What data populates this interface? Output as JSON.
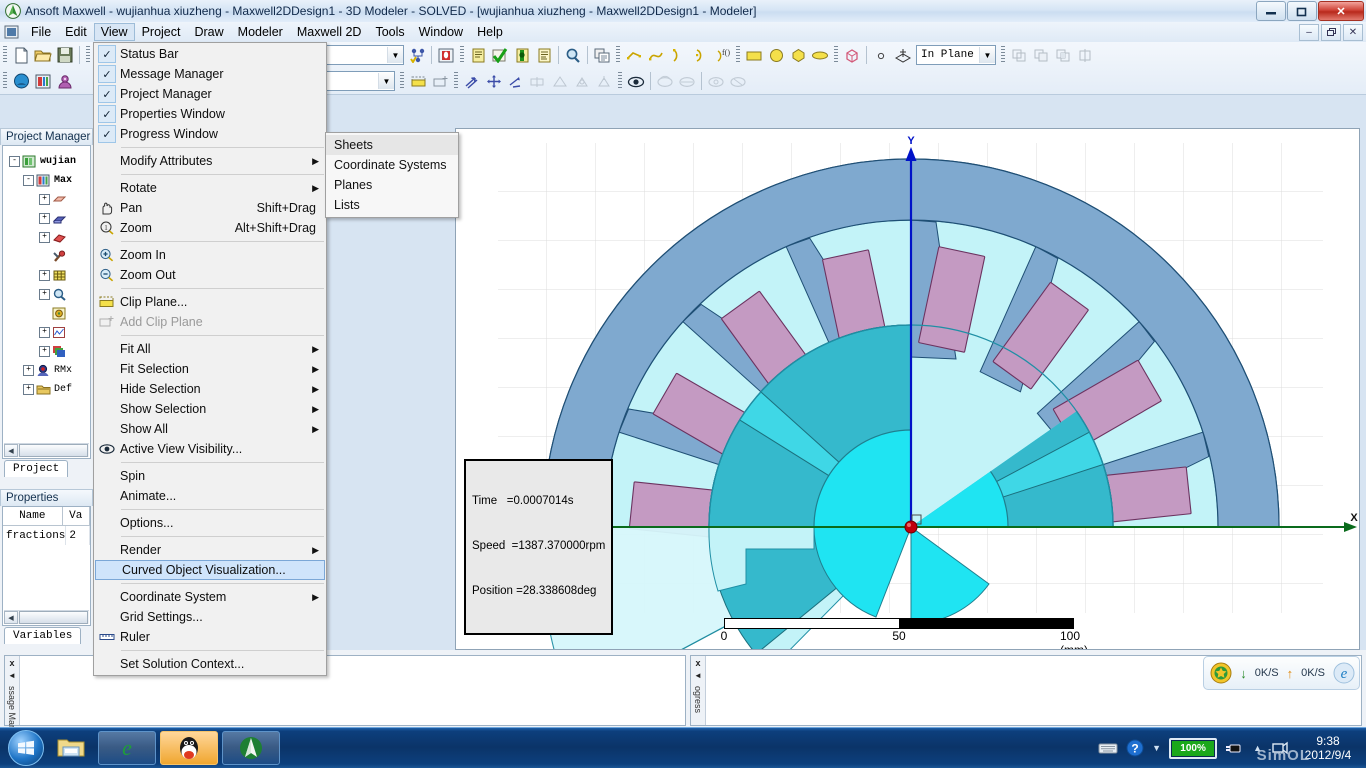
{
  "window": {
    "app_icon": "ansoft-logo-icon",
    "title": "Ansoft Maxwell  - wujianhua  xiuzheng - Maxwell2DDesign1 - 3D Modeler - SOLVED - [wujianhua  xiuzheng - Maxwell2DDesign1 - Modeler]",
    "minimize": "–",
    "maximize": "❐",
    "close": "✕",
    "mdi_minimize": "–",
    "mdi_restore": "❐",
    "mdi_close": "✕"
  },
  "menubar": {
    "items": [
      {
        "label": "File",
        "open": false
      },
      {
        "label": "Edit",
        "open": false
      },
      {
        "label": "View",
        "open": true
      },
      {
        "label": "Project",
        "open": false
      },
      {
        "label": "Draw",
        "open": false
      },
      {
        "label": "Modeler",
        "open": false
      },
      {
        "label": "Maxwell 2D",
        "open": false
      },
      {
        "label": "Tools",
        "open": false
      },
      {
        "label": "Window",
        "open": false
      },
      {
        "label": "Help",
        "open": false
      }
    ]
  },
  "view_menu": {
    "items": [
      {
        "label": "Status Bar",
        "type": "check",
        "checked": true
      },
      {
        "label": "Message Manager",
        "type": "check",
        "checked": true
      },
      {
        "label": "Project Manager",
        "type": "check",
        "checked": true
      },
      {
        "label": "Properties Window",
        "type": "check",
        "checked": true
      },
      {
        "label": "Progress Window",
        "type": "check",
        "checked": true
      },
      {
        "type": "separator"
      },
      {
        "label": "Modify Attributes",
        "type": "submenu"
      },
      {
        "type": "separator"
      },
      {
        "label": "Rotate",
        "type": "submenu"
      },
      {
        "label": "Pan",
        "shortcut": "Shift+Drag",
        "icon": "hand-icon"
      },
      {
        "label": "Zoom",
        "shortcut": "Alt+Shift+Drag",
        "icon": "zoom-icon"
      },
      {
        "type": "separator"
      },
      {
        "label": "Zoom In",
        "icon": "zoom-in-icon"
      },
      {
        "label": "Zoom Out",
        "icon": "zoom-out-icon"
      },
      {
        "type": "separator"
      },
      {
        "label": "Clip Plane...",
        "icon": "clip-plane-icon"
      },
      {
        "label": "Add Clip Plane",
        "icon": "add-clip-plane-icon",
        "disabled": true
      },
      {
        "type": "separator"
      },
      {
        "label": "Fit All",
        "type": "submenu"
      },
      {
        "label": "Fit Selection",
        "type": "submenu"
      },
      {
        "label": "Hide Selection",
        "type": "submenu"
      },
      {
        "label": "Show Selection",
        "type": "submenu"
      },
      {
        "label": "Show All",
        "type": "submenu"
      },
      {
        "label": "Active View Visibility...",
        "icon": "eye-icon"
      },
      {
        "type": "separator"
      },
      {
        "label": "Spin"
      },
      {
        "label": "Animate..."
      },
      {
        "type": "separator"
      },
      {
        "label": "Options..."
      },
      {
        "type": "separator"
      },
      {
        "label": "Render",
        "type": "submenu"
      },
      {
        "label": "Curved Object Visualization...",
        "selected": true
      },
      {
        "type": "separator"
      },
      {
        "label": "Coordinate System",
        "type": "submenu"
      },
      {
        "label": "Grid Settings..."
      },
      {
        "label": "Ruler",
        "icon": "ruler-icon"
      },
      {
        "type": "separator"
      },
      {
        "label": "Set Solution Context..."
      }
    ]
  },
  "submenu": {
    "items": [
      {
        "label": "Sheets",
        "highlighted": true
      },
      {
        "label": "Coordinate Systems"
      },
      {
        "label": "Planes"
      },
      {
        "label": "Lists"
      }
    ]
  },
  "toolbars": {
    "row1": [
      {
        "icon": "new-document-icon"
      },
      {
        "icon": "open-folder-icon"
      },
      {
        "icon": "save-icon"
      },
      {
        "icon": "insert-design-icon"
      },
      {
        "icon": "combo-empty",
        "type": "combo",
        "value": ""
      },
      {
        "icon": "validate-icon"
      },
      {
        "icon": "analyze-icon"
      },
      {
        "icon": "report-icon"
      },
      {
        "icon": "check-icon"
      },
      {
        "icon": "mesh-icon"
      },
      {
        "icon": "document-icon"
      },
      {
        "icon": "magnifier-icon"
      },
      {
        "icon": "copy-icon"
      },
      {
        "icon": "line-icon"
      },
      {
        "icon": "spline-icon"
      },
      {
        "icon": "arc-icon"
      },
      {
        "icon": "arc3pt-icon"
      },
      {
        "icon": "equation-curve-icon"
      },
      {
        "icon": "rectangle-icon"
      },
      {
        "icon": "circle-icon"
      },
      {
        "icon": "polygon-icon"
      },
      {
        "icon": "ellipse-icon"
      },
      {
        "icon": "box-icon"
      },
      {
        "icon": "point-icon"
      },
      {
        "icon": "plane-icon"
      },
      {
        "icon": "in-plane-combo",
        "type": "combo",
        "value": "In Plane"
      },
      {
        "icon": "boolean-unite-icon"
      }
    ],
    "row2": [
      {
        "icon": "undo-icon"
      },
      {
        "icon": "redo-icon"
      },
      {
        "icon": "design-combo",
        "type": "combo",
        "value": ""
      },
      {
        "icon": "clip-plane-icon"
      },
      {
        "icon": "add-clip-plane-icon"
      },
      {
        "icon": "move-icon"
      },
      {
        "icon": "rotate-icon"
      },
      {
        "icon": "duplicate-icon"
      },
      {
        "icon": "mirror-icon"
      },
      {
        "icon": "scale-icon"
      },
      {
        "icon": "offset-icon"
      },
      {
        "icon": "sweep-icon"
      },
      {
        "icon": "eye-icon"
      },
      {
        "icon": "rotate-view-icon"
      },
      {
        "icon": "pan-view-icon"
      },
      {
        "icon": "zoom-view-icon"
      },
      {
        "icon": "fit-view-icon"
      }
    ],
    "in_plane_value": "In Plane"
  },
  "project_manager": {
    "title": "Project Manager",
    "tab": "Project",
    "tree": [
      {
        "label": "wujian",
        "icon": "project-icon",
        "expander": "-",
        "indent": 0
      },
      {
        "label": "Max",
        "icon": "design-icon",
        "expander": "-",
        "indent": 1
      },
      {
        "label": "",
        "icon": "model-icon",
        "expander": "+",
        "indent": 2
      },
      {
        "label": "",
        "icon": "boundary-icon",
        "expander": "+",
        "indent": 2
      },
      {
        "label": "",
        "icon": "excitation-icon",
        "expander": "+",
        "indent": 2
      },
      {
        "label": "",
        "icon": "parameters-icon",
        "expander": "",
        "indent": 2
      },
      {
        "label": "",
        "icon": "mesh-icon",
        "expander": "+",
        "indent": 2
      },
      {
        "label": "",
        "icon": "analysis-icon",
        "expander": "+",
        "indent": 2
      },
      {
        "label": "",
        "icon": "optimetrics-icon",
        "expander": "",
        "indent": 2
      },
      {
        "label": "",
        "icon": "results-icon",
        "expander": "+",
        "indent": 2
      },
      {
        "label": "",
        "icon": "fieldoverlays-icon",
        "expander": "+",
        "indent": 2
      },
      {
        "label": "RMx",
        "icon": "rmxprt-icon",
        "expander": "+",
        "indent": 1
      },
      {
        "label": "Def",
        "icon": "definitions-icon",
        "expander": "+",
        "indent": 1
      }
    ]
  },
  "properties": {
    "title": "Properties",
    "tab": "Variables",
    "columns": [
      "Name",
      "Va"
    ],
    "rows": [
      [
        "fractions",
        "2"
      ]
    ]
  },
  "viewport": {
    "axis_y_label": "Y",
    "axis_x_label": "X",
    "info": {
      "time_label": "Time",
      "time_value": "=0.0007014s",
      "speed_label": "Speed",
      "speed_value": "=1387.370000rpm",
      "position_label": "Position",
      "position_value": "=28.338608deg"
    },
    "scale": {
      "ticks": [
        "0",
        "50",
        "100 (mm)"
      ]
    },
    "colors": {
      "stator_steel": "#7fa9cf",
      "slot_fill": "#c3f3f8",
      "magnet": "#c49ac2",
      "rotor_core": "#3fd7e6",
      "rotor_inner": "#1fe4f2",
      "shaft_band": "#35b9cc",
      "y_axis": "#0012c8",
      "x_axis": "#0a6b1c",
      "origin": "#c0000c",
      "grid": "#dcdcdc"
    }
  },
  "dock": {
    "message_manager_label": "ssage Man",
    "progress_label": "ogress",
    "close_glyph": "x",
    "pin_glyph": "◄"
  },
  "tray_popup": {
    "icon": "antivirus-shield-icon",
    "down_arrow": "↓",
    "down_rate": "0K/S",
    "up_arrow": "↑",
    "up_rate": "0K/S",
    "browser_icon": "internet-explorer-icon"
  },
  "taskbar": {
    "start": "windows-start-orb-icon",
    "quicklaunch": [
      {
        "icon": "explorer-folder-icon"
      }
    ],
    "buttons": [
      {
        "icon": "internet-explorer-icon",
        "active": false
      },
      {
        "icon": "qq-penguin-icon",
        "active": true
      },
      {
        "icon": "maxwell-app-icon",
        "active": false
      }
    ],
    "tray_icons": [
      "keyboard-icon",
      "help-icon",
      "show-hidden-icon",
      "network-icon"
    ],
    "battery_percent": "100%",
    "clock_time": "9:38",
    "clock_date": "2012/9/4",
    "watermark": "SimOL"
  }
}
